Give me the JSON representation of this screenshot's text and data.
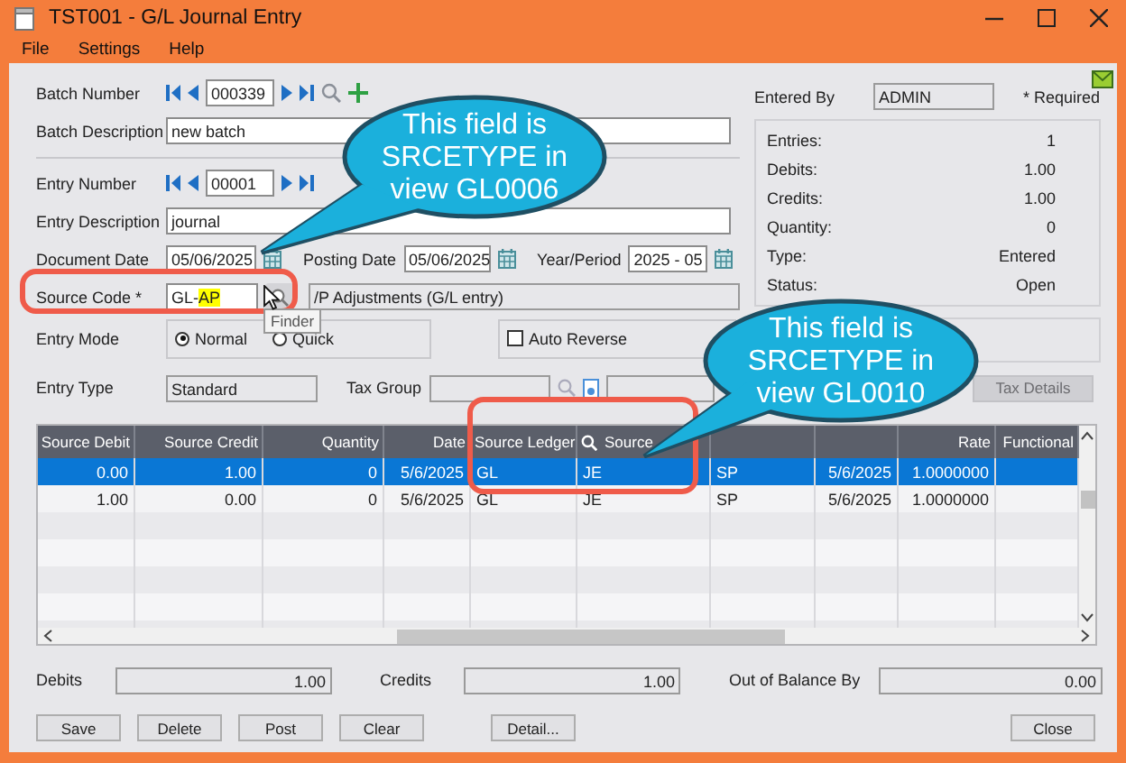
{
  "window": {
    "title": "TST001 - G/L Journal Entry"
  },
  "menu": [
    "File",
    "Settings",
    "Help"
  ],
  "batch": {
    "number_label": "Batch Number",
    "number": "000339",
    "description_label": "Batch Description",
    "description": "new batch"
  },
  "entry": {
    "number_label": "Entry Number",
    "number": "00001",
    "description_label": "Entry Description",
    "description": "journal"
  },
  "dates": {
    "document_label": "Document Date",
    "document": "05/06/2025",
    "posting_label": "Posting Date",
    "posting": "05/06/2025",
    "period_label": "Year/Period",
    "period": "2025 - 05"
  },
  "source_code": {
    "label": "Source Code *",
    "value": "GL-",
    "highlighted": "AP",
    "description": "/P Adjustments (G/L entry)",
    "tooltip": "Finder"
  },
  "entry_mode": {
    "label": "Entry Mode",
    "options": [
      {
        "label": "Normal",
        "selected": true
      },
      {
        "label": "Quick",
        "selected": false
      }
    ]
  },
  "auto_reverse": {
    "label": "Auto Reverse",
    "checked": false
  },
  "entry_type": {
    "label": "Entry Type",
    "value": "Standard"
  },
  "tax_group": {
    "label": "Tax Group"
  },
  "tax_details": {
    "label": "Tax Details",
    "disabled": true
  },
  "entered_by": {
    "label": "Entered By",
    "value": "ADMIN"
  },
  "required_note": "* Required",
  "summary": [
    {
      "label": "Entries:",
      "value": "1"
    },
    {
      "label": "Debits:",
      "value": "1.00"
    },
    {
      "label": "Credits:",
      "value": "1.00"
    },
    {
      "label": "Quantity:",
      "value": "0"
    },
    {
      "label": "Type:",
      "value": "Entered"
    },
    {
      "label": "Status:",
      "value": "Open"
    }
  ],
  "table": {
    "columns": [
      {
        "label": "Source Debit",
        "kind": "number"
      },
      {
        "label": "Source Credit",
        "kind": "number"
      },
      {
        "label": "Quantity",
        "kind": "number"
      },
      {
        "label": "Date",
        "kind": "number"
      },
      {
        "label": "Source Ledger",
        "kind": "text"
      },
      {
        "label": "Source",
        "kind": "finder"
      },
      {
        "kind": "text"
      },
      {
        "kind": "number"
      },
      {
        "label": "Rate",
        "kind": "number"
      },
      {
        "label": "Functional",
        "kind": "number"
      }
    ],
    "rows": [
      {
        "selected": true,
        "cells": [
          "0.00",
          "1.00",
          "0",
          "5/6/2025",
          "GL",
          "JE",
          "SP",
          "5/6/2025",
          "1.0000000"
        ]
      },
      {
        "selected": false,
        "cells": [
          "1.00",
          "0.00",
          "0",
          "5/6/2025",
          "GL",
          "JE",
          "SP",
          "5/6/2025",
          "1.0000000"
        ]
      }
    ]
  },
  "totals": [
    {
      "label": "Debits",
      "value": "1.00"
    },
    {
      "label": "Credits",
      "value": "1.00"
    },
    {
      "label": "Out of Balance By",
      "value": "0.00"
    }
  ],
  "buttons": [
    "Save",
    "Delete",
    "Post",
    "Clear",
    "Detail...",
    "Close"
  ],
  "callouts": [
    {
      "text": "This field is SRCETYPE in view GL0006"
    },
    {
      "text": "This field is SRCETYPE in view GL0010"
    }
  ]
}
